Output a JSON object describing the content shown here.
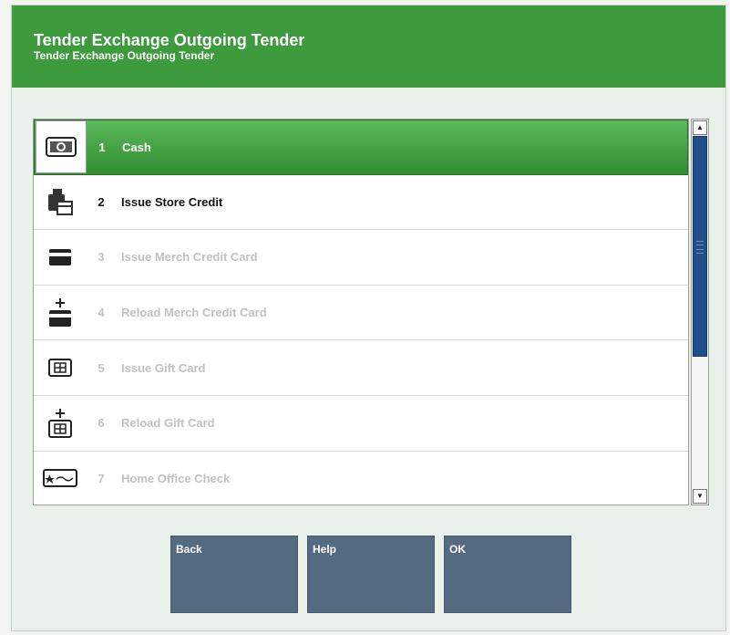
{
  "header": {
    "title": "Tender Exchange Outgoing Tender",
    "subtitle": "Tender Exchange Outgoing Tender"
  },
  "list": {
    "items": [
      {
        "number": "1",
        "label": "Cash",
        "icon": "cash-icon",
        "state": "selected"
      },
      {
        "number": "2",
        "label": "Issue Store Credit",
        "icon": "store-credit-icon",
        "state": "enabled"
      },
      {
        "number": "3",
        "label": "Issue Merch Credit Card",
        "icon": "credit-card-icon",
        "state": "disabled"
      },
      {
        "number": "4",
        "label": "Reload Merch Credit Card",
        "icon": "reload-credit-card-icon",
        "state": "disabled"
      },
      {
        "number": "5",
        "label": "Issue Gift Card",
        "icon": "gift-card-icon",
        "state": "disabled"
      },
      {
        "number": "6",
        "label": "Reload Gift Card",
        "icon": "reload-gift-card-icon",
        "state": "disabled"
      },
      {
        "number": "7",
        "label": "Home Office Check",
        "icon": "check-icon",
        "state": "disabled"
      }
    ]
  },
  "buttons": {
    "back": "Back",
    "help": "Help",
    "ok": "OK"
  },
  "colors": {
    "header": "#3d9a3d",
    "selected_row": "#3fa03f",
    "button": "#546a80",
    "scroll_thumb": "#1f4e8a"
  }
}
